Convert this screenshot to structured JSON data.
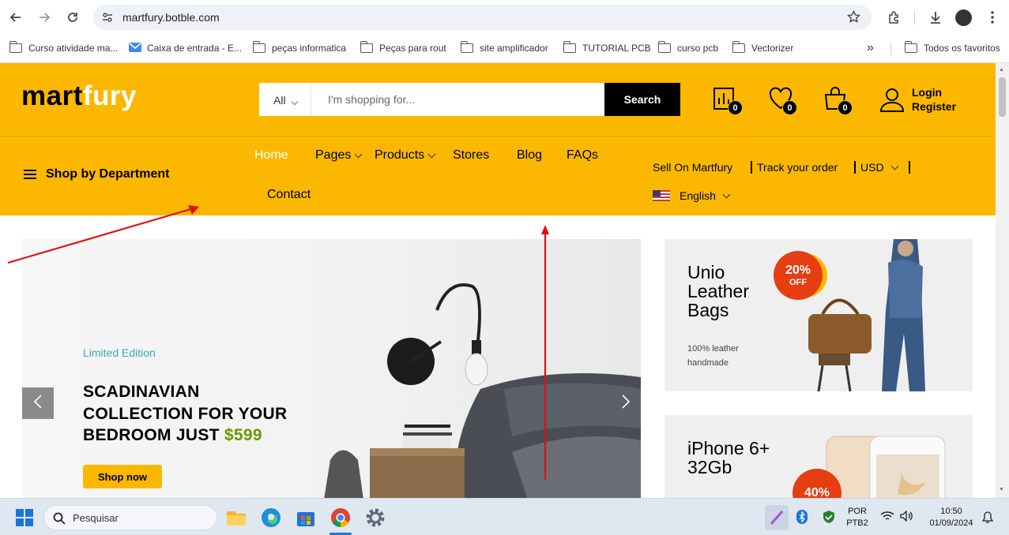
{
  "browser": {
    "url": "martfury.botble.com",
    "bookmarks": [
      "Curso atividade ma...",
      "Caixa de entrada - E...",
      "peças informatica",
      "Peças para rout",
      "site amplificador",
      "TUTORIAL PCB",
      "curso pcb",
      "Vectorizer"
    ],
    "all_favorites": "Todos os favoritos",
    "overflow": "»"
  },
  "site": {
    "logo_part1": "mart",
    "logo_part2": "fury",
    "search": {
      "category": "All",
      "placeholder": "I'm shopping for...",
      "button": "Search"
    },
    "counters": {
      "compare": "0",
      "wishlist": "0",
      "cart": "0"
    },
    "login": "Login",
    "register": "Register",
    "shop_by_department": "Shop by Department",
    "menu": [
      "Home",
      "Pages",
      "Products",
      "Stores",
      "Blog",
      "FAQs",
      "Contact"
    ],
    "top_links": {
      "sell": "Sell On Martfury",
      "track": "Track your order",
      "currency": "USD",
      "language": "English"
    },
    "colors": {
      "brand_yellow": "#fcb800",
      "price_green": "#669900",
      "badge_red": "#e63d12"
    }
  },
  "banner": {
    "tag": "Limited Edition",
    "title_line1": "SCADINAVIAN",
    "title_line2": "COLLECTION FOR YOUR",
    "title_line3": "BEDROOM JUST",
    "price": "$599",
    "cta": "Shop now"
  },
  "promos": [
    {
      "title_line1": "Unio",
      "title_line2": "Leather",
      "title_line3": "Bags",
      "sub_line1": "100% leather",
      "sub_line2": "handmade",
      "badge_pct": "20%",
      "badge_off": "OFF"
    },
    {
      "title_line1": "iPhone 6+",
      "title_line2": "32Gb",
      "badge_pct": "40%"
    }
  ],
  "taskbar": {
    "search_placeholder": "Pesquisar",
    "lang1": "POR",
    "lang2": "PTB2",
    "time": "10:50",
    "date": "01/09/2024"
  }
}
